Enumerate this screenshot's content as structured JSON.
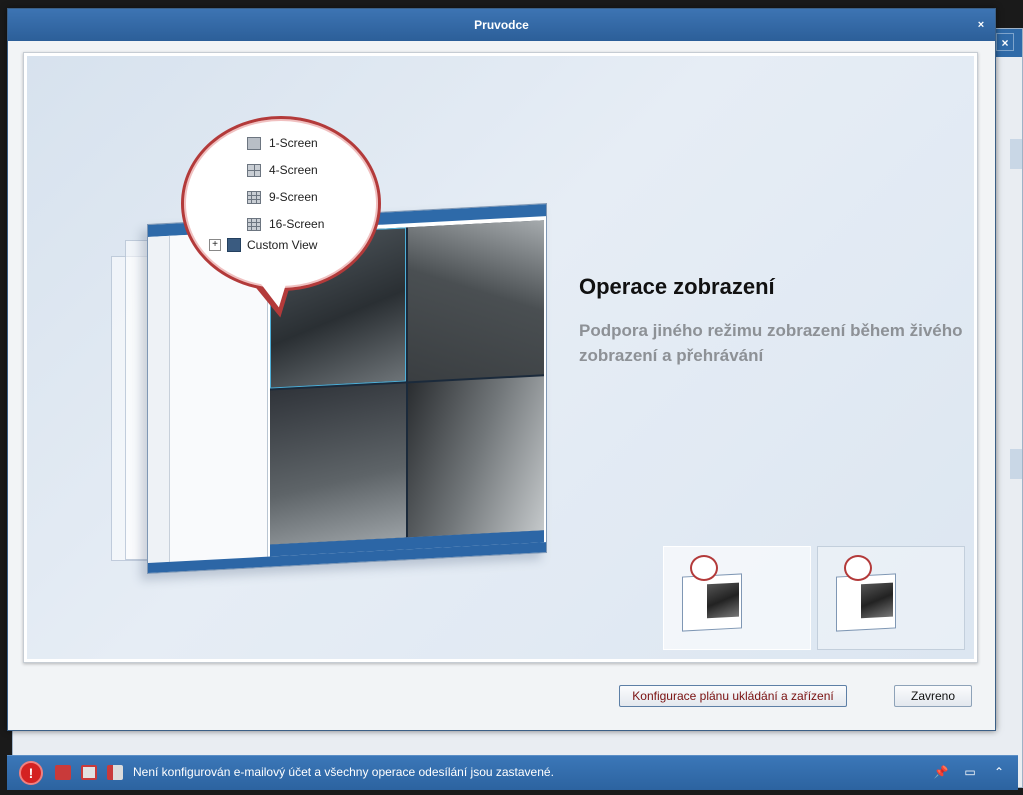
{
  "dialog": {
    "title": "Pruvodce",
    "close_glyph": "×"
  },
  "background_window": {
    "close_glyph": "×"
  },
  "page": {
    "headline": "Operace zobrazení",
    "description": "Podpora jiného režimu zobrazení během živého zobrazení a přehrávání"
  },
  "illustration": {
    "menu_items": [
      {
        "label": "1-Screen",
        "icon": "single-screen-icon"
      },
      {
        "label": "4-Screen",
        "icon": "quad-screen-icon"
      },
      {
        "label": "9-Screen",
        "icon": "nine-screen-icon"
      },
      {
        "label": "16-Screen",
        "icon": "sixteen-screen-icon"
      }
    ],
    "custom_view": {
      "label": "Custom View",
      "expand_glyph": "+"
    }
  },
  "thumbnails": {
    "count": 2,
    "active_index": 0
  },
  "buttons": {
    "config_label": "Konfigurace plánu ukládání a zařízení",
    "close_label": "Zavreno"
  },
  "statusbar": {
    "alarm_glyph": "!",
    "message": "Není konfigurován e-mailový účet a všechny operace odesílání jsou zastavené.",
    "pin_glyph": "📌",
    "window_glyph": "▭",
    "collapse_glyph": "⌃"
  },
  "colors": {
    "titlebar": "#2f6aa8",
    "accent_red": "#b33a3a",
    "headline_text": "#111111",
    "description_text": "#8d9196"
  }
}
